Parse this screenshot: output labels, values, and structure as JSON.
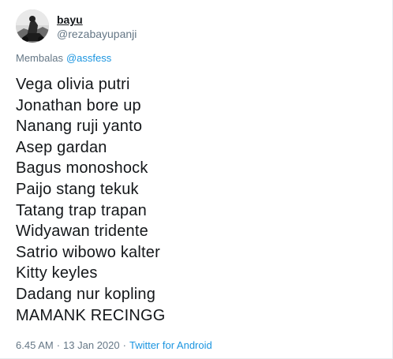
{
  "user": {
    "display_name": "bayu",
    "username": "@rezabayupanji"
  },
  "reply": {
    "prefix": "Membalas",
    "mention": "@assfess"
  },
  "lines": [
    "Vega olivia putri",
    "Jonathan bore up",
    "Nanang ruji yanto",
    "Asep gardan",
    "Bagus monoshock",
    "Paijo stang tekuk",
    "Tatang trap trapan",
    "Widyawan tridente",
    "Satrio wibowo kalter",
    "Kitty keyles",
    "Dadang nur kopling",
    "MAMANK RECINGG"
  ],
  "meta": {
    "time": "6.45 AM",
    "separator1": "·",
    "date": "13 Jan 2020",
    "separator2": "·",
    "source": "Twitter for Android"
  },
  "colors": {
    "text": "#14171a",
    "secondary": "#657786",
    "link": "#1b95e0"
  }
}
